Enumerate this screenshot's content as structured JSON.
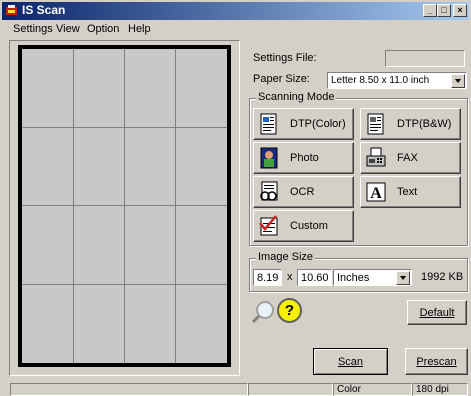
{
  "window": {
    "title": "IS Scan",
    "min": "_",
    "max": "□",
    "close": "×"
  },
  "menu": [
    "Settings",
    "View",
    "Option",
    "Help"
  ],
  "settings_file": {
    "label": "Settings File:",
    "value": ""
  },
  "paper_size": {
    "label": "Paper Size:",
    "value": "Letter 8.50 x 11.0 inch"
  },
  "scanning_mode": {
    "title": "Scanning Mode",
    "buttons": [
      "DTP(Color)",
      "DTP(B&W)",
      "Photo",
      "FAX",
      "OCR",
      "Text",
      "Custom"
    ]
  },
  "image_size": {
    "title": "Image Size",
    "width": "8.19",
    "x": "x",
    "height": "10.60",
    "units": "Inches",
    "filesize": "1992 KB"
  },
  "buttons": {
    "default": "Default",
    "scan": "Scan",
    "prescan": "Prescan"
  },
  "help_glyph": "?",
  "status": {
    "mode": "Color",
    "dpi": "180 dpi"
  }
}
